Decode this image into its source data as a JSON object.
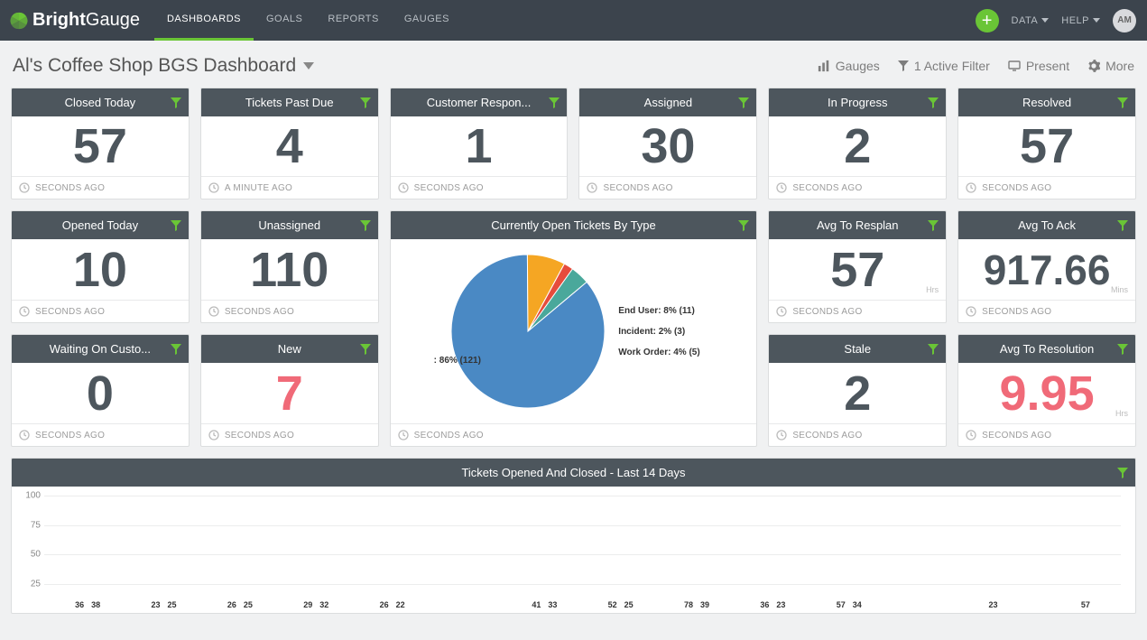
{
  "brand": {
    "bright": "Bright",
    "gauge": "Gauge"
  },
  "nav": {
    "dashboards": "DASHBOARDS",
    "goals": "GOALS",
    "reports": "REPORTS",
    "gauges": "GAUGES",
    "data": "DATA",
    "help": "HELP",
    "avatar": "AM"
  },
  "title": "Al's Coffee Shop BGS Dashboard",
  "actions": {
    "gauges": "Gauges",
    "filter": "1 Active Filter",
    "present": "Present",
    "more": "More"
  },
  "cards": {
    "closed_today": {
      "title": "Closed Today",
      "value": "57",
      "footer": "SECONDS AGO"
    },
    "past_due": {
      "title": "Tickets Past Due",
      "value": "4",
      "footer": "A MINUTE AGO"
    },
    "cust_resp": {
      "title": "Customer Respon...",
      "value": "1",
      "footer": "SECONDS AGO"
    },
    "assigned": {
      "title": "Assigned",
      "value": "30",
      "footer": "SECONDS AGO"
    },
    "in_progress": {
      "title": "In Progress",
      "value": "2",
      "footer": "SECONDS AGO"
    },
    "resolved": {
      "title": "Resolved",
      "value": "57",
      "footer": "SECONDS AGO"
    },
    "opened_today": {
      "title": "Opened Today",
      "value": "10",
      "footer": "SECONDS AGO"
    },
    "unassigned": {
      "title": "Unassigned",
      "value": "110",
      "footer": "SECONDS AGO"
    },
    "pie": {
      "title": "Currently Open Tickets By Type",
      "footer": "SECONDS AGO",
      "labels": {
        "enduser": "End User: 8% (11)",
        "incident": "Incident: 2% (3)",
        "workorder": "Work Order: 4% (5)",
        "blank": ": 86% (121)"
      }
    },
    "avg_resplan": {
      "title": "Avg To Resplan",
      "value": "57",
      "unit": "Hrs",
      "footer": "SECONDS AGO"
    },
    "avg_ack": {
      "title": "Avg To Ack",
      "value": "917.66",
      "unit": "Mins",
      "footer": "SECONDS AGO"
    },
    "waiting": {
      "title": "Waiting On Custo...",
      "value": "0",
      "footer": "SECONDS AGO"
    },
    "new": {
      "title": "New",
      "value": "7",
      "footer": "SECONDS AGO",
      "red": true
    },
    "stale": {
      "title": "Stale",
      "value": "2",
      "footer": "SECONDS AGO"
    },
    "avg_resolution": {
      "title": "Avg To Resolution",
      "value": "9.95",
      "unit": "Hrs",
      "footer": "SECONDS AGO",
      "red": true
    },
    "barchart": {
      "title": "Tickets Opened And Closed - Last 14 Days"
    }
  },
  "chart_data": [
    {
      "type": "pie",
      "title": "Currently Open Tickets By Type",
      "series": [
        {
          "name": "",
          "value": 121,
          "pct": 86,
          "color": "#4a89c4"
        },
        {
          "name": "End User",
          "value": 11,
          "pct": 8,
          "color": "#f5a623"
        },
        {
          "name": "Incident",
          "value": 3,
          "pct": 2,
          "color": "#e64c3c"
        },
        {
          "name": "Work Order",
          "value": 5,
          "pct": 4,
          "color": "#4aa89b"
        }
      ]
    },
    {
      "type": "bar",
      "title": "Tickets Opened And Closed - Last 14 Days",
      "ylabel": "",
      "ylim": [
        0,
        100
      ],
      "yticks": [
        25,
        50,
        75,
        100
      ],
      "series": [
        {
          "name": "Opened",
          "color": "#4a89c4",
          "values": [
            36,
            23,
            26,
            29,
            26,
            null,
            41,
            52,
            78,
            36,
            57,
            null,
            23,
            null
          ]
        },
        {
          "name": "Closed",
          "color": "#f5a623",
          "values": [
            38,
            25,
            25,
            32,
            22,
            null,
            33,
            25,
            39,
            23,
            34,
            null,
            null,
            57
          ]
        }
      ]
    }
  ]
}
